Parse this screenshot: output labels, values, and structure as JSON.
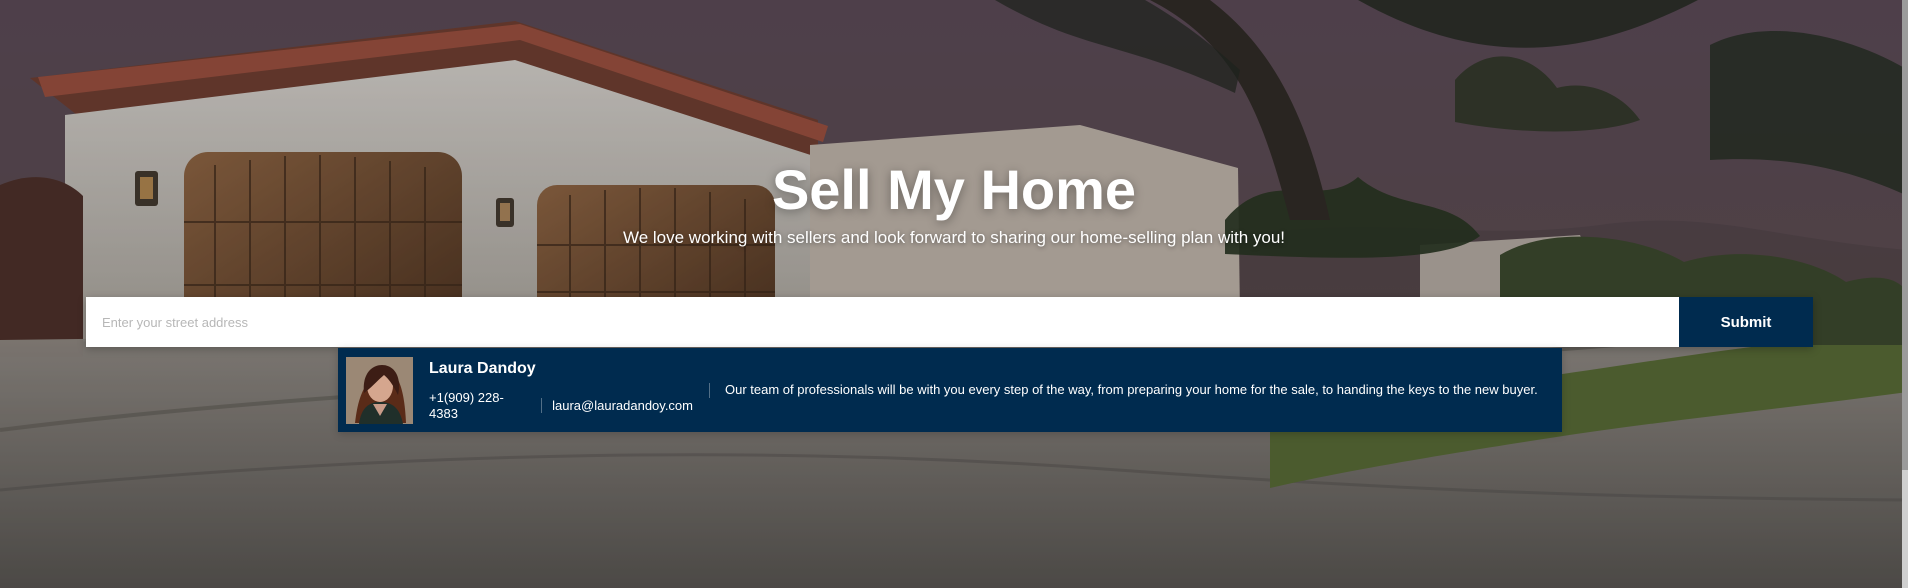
{
  "hero": {
    "title": "Sell My Home",
    "subtitle": "We love working with sellers and look forward to sharing our home-selling plan with you!"
  },
  "form": {
    "address_placeholder": "Enter your street address",
    "submit_label": "Submit"
  },
  "agent": {
    "name": "Laura Dandoy",
    "phone": "+1(909) 228-4383",
    "email": "laura@lauradandoy.com",
    "message": "Our team of professionals will be with you every step of the way, from preparing your home for the sale, to handing the keys to the new buyer."
  },
  "colors": {
    "brand_navy": "#002b4f",
    "text_light": "#ffffff",
    "input_background": "#ffffff"
  },
  "icons": {
    "agent_photo": "agent-avatar"
  }
}
